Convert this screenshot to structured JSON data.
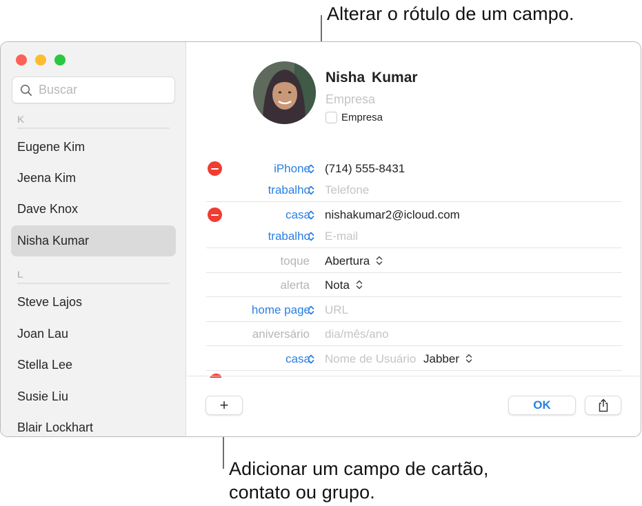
{
  "callouts": {
    "top": "Alterar o rótulo de um campo.",
    "bottom_line1": "Adicionar um campo de cartão,",
    "bottom_line2": "contato ou grupo."
  },
  "window": {
    "traffic_lights": [
      "close",
      "minimize",
      "zoom"
    ],
    "colors": {
      "close": "#fe5f57",
      "minimize": "#febc2e",
      "zoom": "#28c840",
      "accent": "#2a7fe1",
      "delete": "#f03c32"
    }
  },
  "sidebar": {
    "search_placeholder": "Buscar",
    "sections": [
      {
        "letter": "K",
        "contacts": [
          "Eugene Kim",
          "Jeena Kim",
          "Dave Knox",
          "Nisha Kumar"
        ]
      },
      {
        "letter": "L",
        "contacts": [
          "Steve Lajos",
          "Joan Lau",
          "Stella Lee",
          "Susie Liu",
          "Blair Lockhart"
        ]
      }
    ],
    "selected": "Nisha Kumar"
  },
  "card": {
    "first_name": "Nisha",
    "last_name": "Kumar",
    "company_placeholder": "Empresa",
    "company_checkbox_label": "Empresa",
    "company_checked": false,
    "fields": [
      {
        "label": "iPhone",
        "label_editable": true,
        "value": "(714) 555-8431",
        "placeholder": "",
        "deletable": true
      },
      {
        "label": "trabalho",
        "label_editable": true,
        "value": "",
        "placeholder": "Telefone",
        "deletable": false
      },
      {
        "label": "casa",
        "label_editable": true,
        "value": "nishakumar2@icloud.com",
        "placeholder": "",
        "deletable": true
      },
      {
        "label": "trabalho",
        "label_editable": true,
        "value": "",
        "placeholder": "E-mail",
        "deletable": false
      },
      {
        "label": "toque",
        "label_editable": false,
        "value": "Abertura",
        "placeholder": "",
        "popup": true
      },
      {
        "label": "alerta",
        "label_editable": false,
        "value": "Nota",
        "placeholder": "",
        "popup": true
      },
      {
        "label": "home page",
        "label_editable": true,
        "value": "",
        "placeholder": "URL"
      },
      {
        "label": "aniversário",
        "label_editable": false,
        "value": "",
        "placeholder": "dia/mês/ano"
      },
      {
        "label": "casa",
        "label_editable": true,
        "value": "",
        "placeholder": "Nome de Usuário",
        "service": "Jabber"
      }
    ]
  },
  "footer": {
    "add_label": "+",
    "ok_label": "OK",
    "share_icon": "share-icon"
  }
}
